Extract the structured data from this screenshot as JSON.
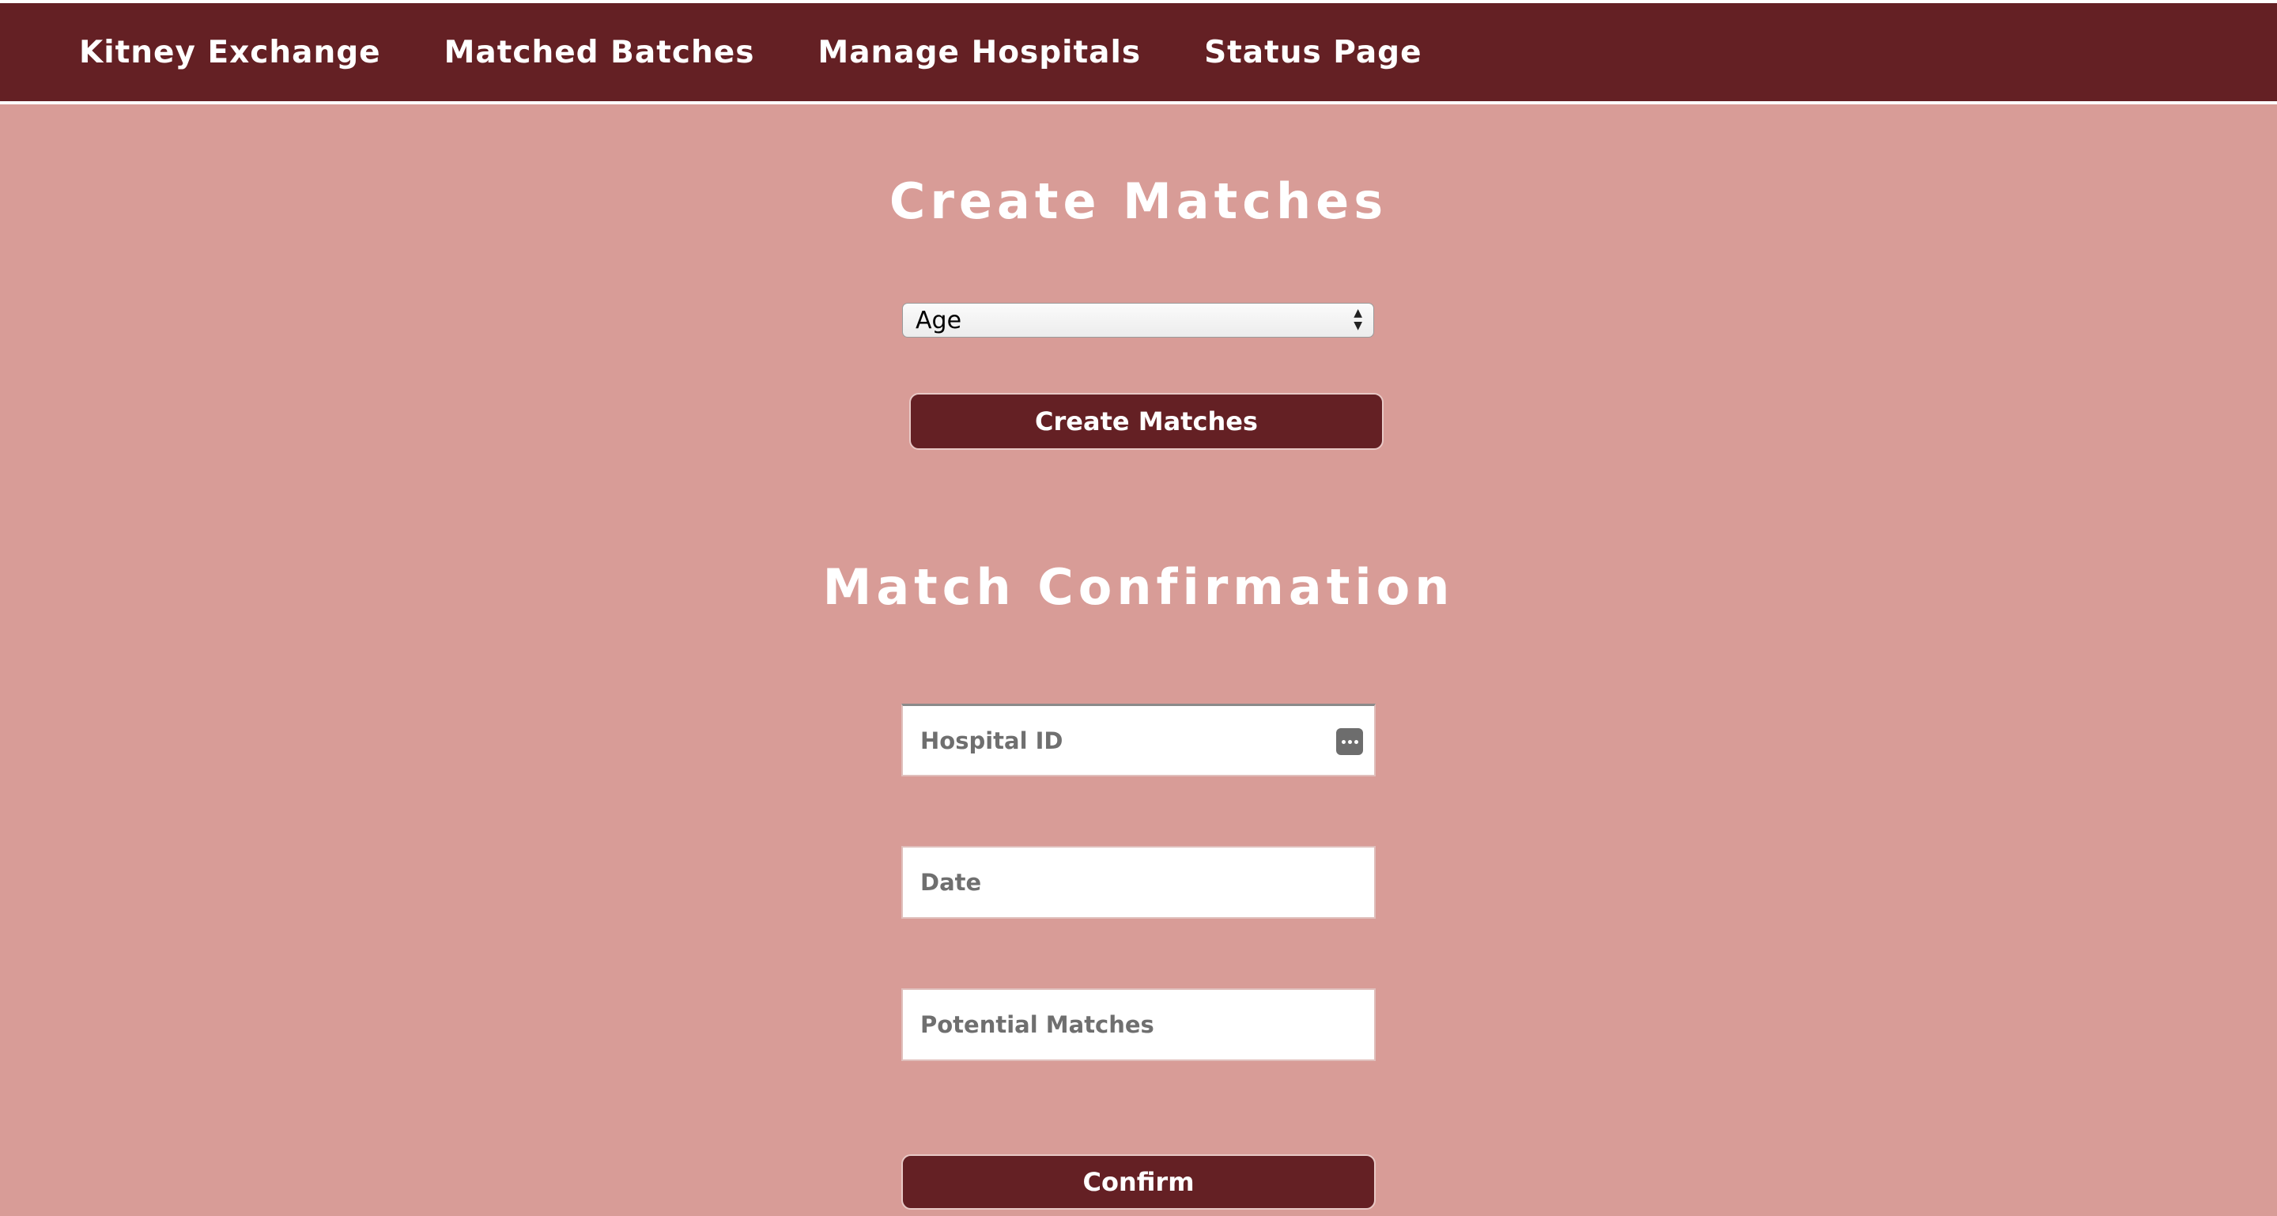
{
  "nav": {
    "items": [
      {
        "label": "Kitney Exchange"
      },
      {
        "label": "Matched Batches"
      },
      {
        "label": "Manage Hospitals"
      },
      {
        "label": "Status Page"
      }
    ]
  },
  "create": {
    "heading": "Create Matches",
    "criteria_selected": "Age",
    "button_label": "Create Matches"
  },
  "confirmation": {
    "heading": "Match Confirmation",
    "hospital_id_placeholder": "Hospital ID",
    "date_placeholder": "Date",
    "potential_matches_placeholder": "Potential Matches",
    "button_label": "Confirm"
  },
  "colors": {
    "nav_background": "#642024",
    "page_background": "#d89c97",
    "button_background": "#642024",
    "text_light": "#ffffff"
  },
  "icons": {
    "select_arrows": "updown-chevron-icon",
    "password_manager": "key-autofill-icon"
  }
}
